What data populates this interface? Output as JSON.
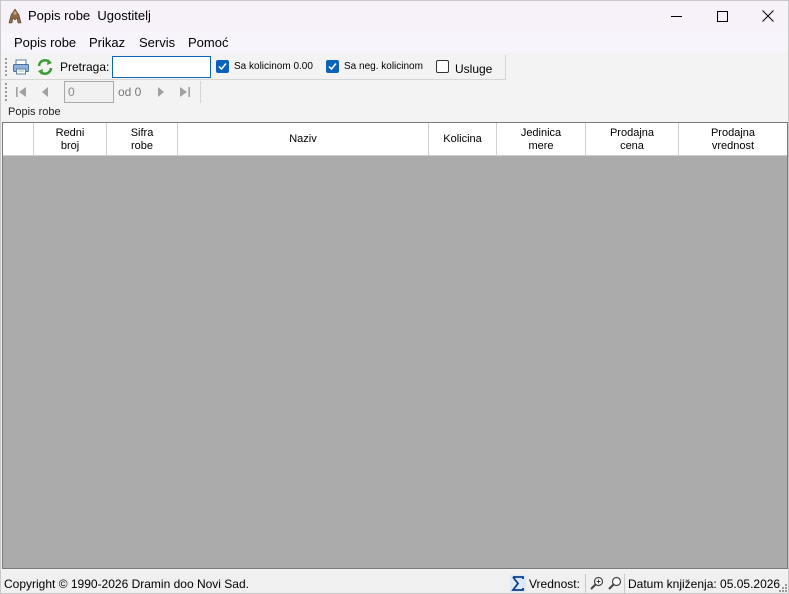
{
  "window": {
    "title": "Popis robe  Ugostitelj",
    "min_icon": "minimize-icon",
    "max_icon": "maximize-icon",
    "close_icon": "close-icon"
  },
  "menu": [
    "Popis robe",
    "Prikaz",
    "Servis",
    "Pomoć"
  ],
  "toolbar": {
    "print_icon": "print-icon",
    "refresh_icon": "refresh-icon",
    "search_label": "Pretraga:",
    "search_value": "",
    "chk_zero_label": "Sa kolicinom 0.00",
    "chk_zero_checked": true,
    "chk_neg_label": "Sa neg. kolicinom",
    "chk_neg_checked": true,
    "chk_services_label": "Usluge",
    "chk_services_checked": false
  },
  "navigator": {
    "page_value": "0",
    "of_label": "od 0"
  },
  "section_label": "Popis robe",
  "grid": {
    "columns": [
      "Redni\nbroj",
      "Sifra\nrobe",
      "Naziv",
      "Kolicina",
      "Jedinica\nmere",
      "Prodajna\ncena",
      "Prodajna\nvrednost"
    ],
    "rows": []
  },
  "status": {
    "copyright": "Copyright © 1990-2026 Dramin doo Novi Sad.",
    "vrednost_label": "Vrednost:",
    "datum_label": "Datum knjiženja: 05.05.2026"
  },
  "colors": {
    "accent": "#0a63b8",
    "grid_background": "#ababab",
    "titlebar": "#f7f2fa"
  }
}
